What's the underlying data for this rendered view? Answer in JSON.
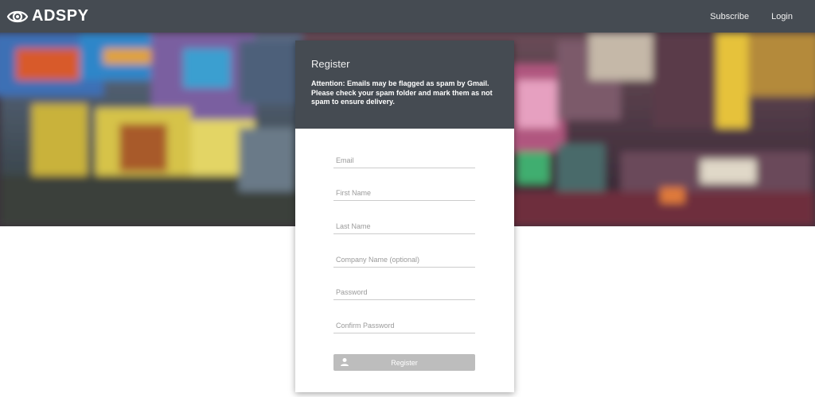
{
  "navbar": {
    "brand": "ADSPY",
    "brand_icon": "eye-logo-icon",
    "links": [
      "Subscribe",
      "Login"
    ]
  },
  "register": {
    "title": "Register",
    "notice": "Attention: Emails may be flagged as spam by Gmail. Please check your spam folder and mark them as not spam to ensure delivery.",
    "fields": {
      "email": "Email",
      "first_name": "First Name",
      "last_name": "Last Name",
      "company": "Company Name (optional)",
      "password": "Password",
      "confirm_password": "Confirm Password"
    },
    "submit_label": "Register",
    "submit_icon": "user-icon"
  },
  "colors": {
    "navbar": "#454b52",
    "button": "#bdbdbd"
  }
}
